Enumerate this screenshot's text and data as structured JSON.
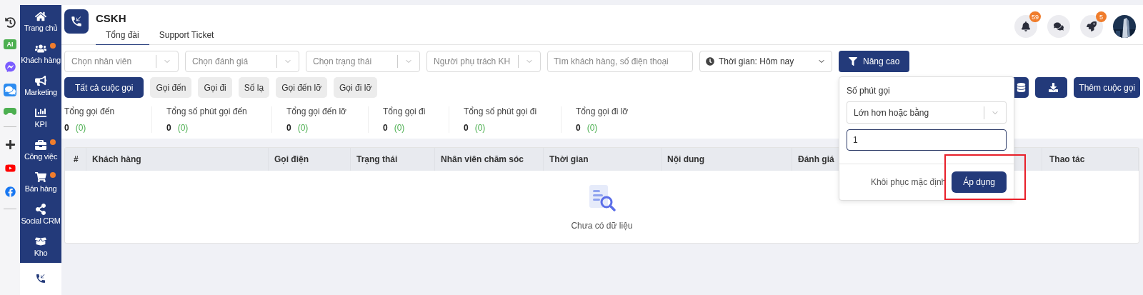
{
  "rail": {
    "ai_label": "AI"
  },
  "sidebar": {
    "items": [
      {
        "label": "Trang chủ",
        "kind": "home",
        "dot": false,
        "selected": false
      },
      {
        "label": "Khách hàng",
        "kind": "users",
        "dot": true,
        "selected": false
      },
      {
        "label": "Marketing",
        "kind": "megaphone",
        "dot": false,
        "selected": false
      },
      {
        "label": "KPI",
        "kind": "chart",
        "dot": false,
        "selected": false
      },
      {
        "label": "Công việc",
        "kind": "briefcase",
        "dot": true,
        "selected": false
      },
      {
        "label": "Bán hàng",
        "kind": "cart",
        "dot": true,
        "selected": false
      },
      {
        "label": "Social CRM",
        "kind": "share",
        "dot": false,
        "selected": false
      },
      {
        "label": "Kho",
        "kind": "box",
        "dot": false,
        "selected": false
      },
      {
        "kind": "phone",
        "dot": false,
        "selected": true
      }
    ]
  },
  "header": {
    "title": "CSKH",
    "tabs": [
      {
        "label": "Tổng đài",
        "selected": true
      },
      {
        "label": "Support Ticket",
        "selected": false
      }
    ],
    "notification_count": "59",
    "rocket_count": "5"
  },
  "filters": {
    "selects": [
      {
        "placeholder": "Chọn nhân viên"
      },
      {
        "placeholder": "Chọn đánh giá"
      },
      {
        "placeholder": "Chọn trạng thái"
      },
      {
        "placeholder": "Người phụ trách KH"
      }
    ],
    "search": {
      "placeholder": "Tìm khách hàng, số điện thoại"
    },
    "time": "Thời gian: Hôm nay",
    "advanced_button": "Nâng cao"
  },
  "call_types": [
    {
      "label": "Tất cả cuộc gọi",
      "selected": true
    },
    {
      "label": "Gọi đến",
      "selected": false
    },
    {
      "label": "Gọi đi",
      "selected": false
    },
    {
      "label": "Số lạ",
      "selected": false
    },
    {
      "label": "Gọi đến lỡ",
      "selected": false
    },
    {
      "label": "Gọi đi lỡ",
      "selected": false
    }
  ],
  "actions": {
    "add_button": "Thêm cuộc gọi"
  },
  "stats": [
    {
      "label": "Tổng gọi đến",
      "value": "0",
      "sub": "(0)"
    },
    {
      "label": "Tổng số phút gọi đến",
      "value": "0",
      "sub": "(0)"
    },
    {
      "label": "Tổng gọi đến lỡ",
      "value": "0",
      "sub": "(0)"
    },
    {
      "label": "Tổng gọi đi",
      "value": "0",
      "sub": "(0)"
    },
    {
      "label": "Tổng số phút gọi đi",
      "value": "0",
      "sub": "(0)"
    },
    {
      "label": "Tổng gọi đi lỡ",
      "value": "0",
      "sub": "(0)"
    }
  ],
  "table": {
    "columns": [
      "#",
      "Khách hàng",
      "Gọi điện",
      "Trạng thái",
      "Nhân viên chăm sóc",
      "Thời gian",
      "Nội dung",
      "Đánh giá",
      "Thao tác"
    ],
    "empty": "Chưa có dữ liệu"
  },
  "advanced_filter": {
    "label": "Số phút gọi",
    "operator": "Lớn hơn hoặc bằng",
    "value": "1",
    "reset_button": "Khôi phục mặc định",
    "apply_button": "Áp dụng"
  }
}
